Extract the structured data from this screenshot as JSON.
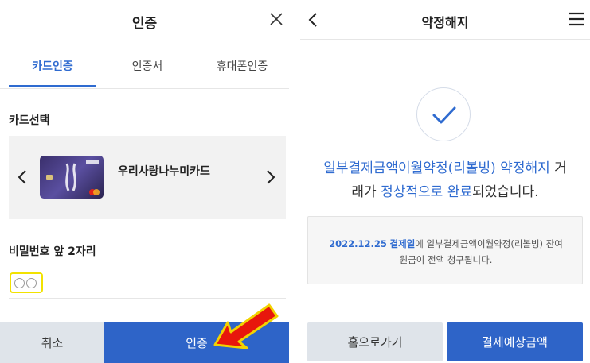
{
  "left": {
    "title": "인증",
    "tabs": [
      {
        "label": "카드인증",
        "active": true
      },
      {
        "label": "인증서",
        "active": false
      },
      {
        "label": "휴대폰인증",
        "active": false
      }
    ],
    "card_section_label": "카드선택",
    "card_name": "우리사랑나누미카드",
    "password_label": "비밀번호 앞 2자리",
    "password_placeholder": "○○",
    "cancel_label": "취소",
    "auth_label": "인증"
  },
  "right": {
    "title": "약정해지",
    "message": {
      "line1_hl": "일부결제금액이월약정(리볼빙) 약정해지",
      "line1_rest": " 거",
      "line2_pre": "래가 ",
      "line2_hl": "정상적으로 완료",
      "line2_rest": "되었습니다."
    },
    "notice": {
      "date": "2022.12.25",
      "hl": "결제일",
      "line1_rest": "에 일부결제금액이월약정(리볼빙) 잔여",
      "line2": "원금이 전액 청구됩니다."
    },
    "home_label": "홈으로가기",
    "estimate_label": "결제예상금액"
  },
  "colors": {
    "accent": "#2f6bd0",
    "button_primary": "#2e64c8",
    "button_secondary": "#dfe4ea",
    "highlight_box": "#f2e200",
    "arrow": "#e8160c"
  }
}
